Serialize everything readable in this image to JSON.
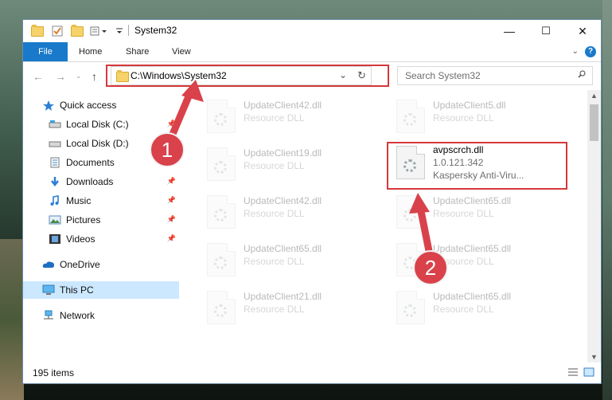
{
  "window": {
    "title": "System32",
    "controls": {
      "minimize": "—",
      "maximize": "☐",
      "close": "✕"
    }
  },
  "ribbon": {
    "tabs": [
      "File",
      "Home",
      "Share",
      "View"
    ],
    "help": "?"
  },
  "navigation": {
    "address_path": "C:\\Windows\\System32",
    "search_placeholder": "Search System32"
  },
  "sidebar": {
    "items": [
      {
        "label": "Quick access",
        "icon": "star-icon",
        "pinned": false
      },
      {
        "label": "Local Disk (C:)",
        "icon": "drive-icon",
        "pinned": true
      },
      {
        "label": "Local Disk (D:)",
        "icon": "drive-icon",
        "pinned": false
      },
      {
        "label": "Documents",
        "icon": "document-icon",
        "pinned": true
      },
      {
        "label": "Downloads",
        "icon": "download-icon",
        "pinned": true
      },
      {
        "label": "Music",
        "icon": "music-icon",
        "pinned": true
      },
      {
        "label": "Pictures",
        "icon": "pictures-icon",
        "pinned": true
      },
      {
        "label": "Videos",
        "icon": "videos-icon",
        "pinned": true
      },
      {
        "label": "OneDrive",
        "icon": "cloud-icon",
        "pinned": false
      },
      {
        "label": "This PC",
        "icon": "computer-icon",
        "pinned": false,
        "selected": true
      },
      {
        "label": "Network",
        "icon": "network-icon",
        "pinned": false
      }
    ]
  },
  "files": [
    {
      "name": "UpdateClient42.dll",
      "sub": "Resource DLL",
      "faded": true
    },
    {
      "name": "UpdateClient5.dll",
      "sub": "Resource DLL",
      "faded": true
    },
    {
      "name": "UpdateClient19.dll",
      "sub": "Resource DLL",
      "faded": true
    },
    {
      "name": "avpscrch.dll",
      "sub": "1.0.121.342",
      "sub2": "Kaspersky Anti-Viru...",
      "faded": false
    },
    {
      "name": "UpdateClient42.dll",
      "sub": "Resource DLL",
      "faded": true
    },
    {
      "name": "UpdateClient65.dll",
      "sub": "Resource DLL",
      "faded": true
    },
    {
      "name": "UpdateClient65.dll",
      "sub": "Resource DLL",
      "faded": true
    },
    {
      "name": "UpdateClient65.dll",
      "sub": "Resource DLL",
      "faded": true
    },
    {
      "name": "UpdateClient21.dll",
      "sub": "Resource DLL",
      "faded": true
    },
    {
      "name": "UpdateClient65.dll",
      "sub": "Resource DLL",
      "faded": true
    }
  ],
  "status": {
    "item_count": "195 items"
  },
  "annotations": {
    "step1": "1",
    "step2": "2",
    "color": "#d6383a"
  }
}
